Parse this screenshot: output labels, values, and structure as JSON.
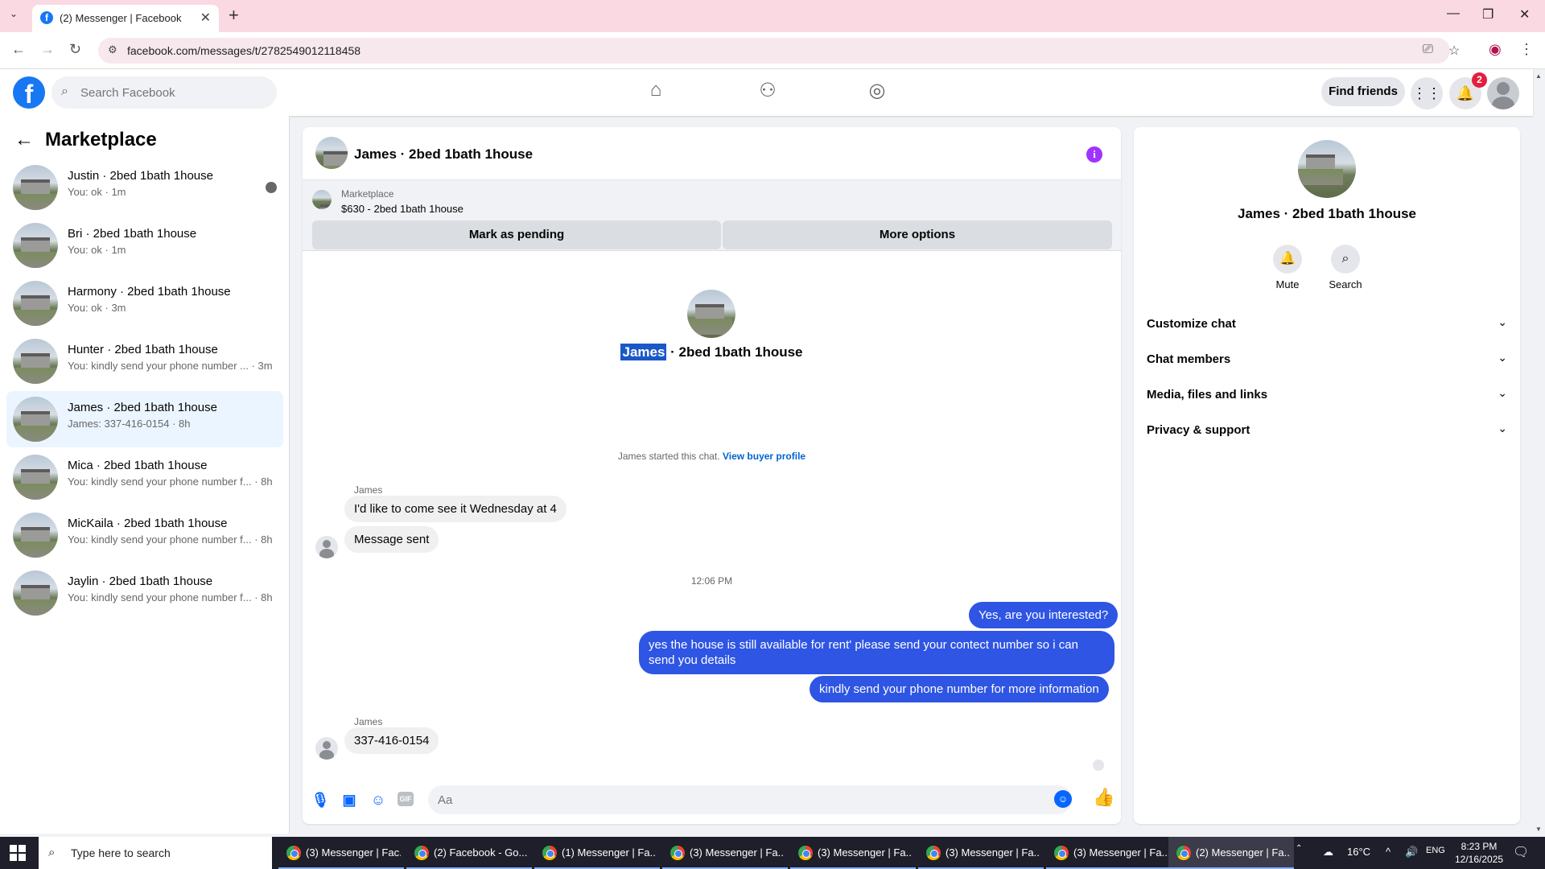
{
  "browser": {
    "tab_title": "(2) Messenger | Facebook",
    "tab_favicon": "f",
    "url": "facebook.com/messages/t/2782549012118458"
  },
  "fb": {
    "search_placeholder": "Search Facebook",
    "find_friends": "Find friends",
    "notif_count": "2"
  },
  "sidebar": {
    "title": "Marketplace",
    "conversations": [
      {
        "name": "Justin · 2bed 1bath 1house",
        "sub": "You: ok · 1m"
      },
      {
        "name": "Bri · 2bed 1bath 1house",
        "sub": "You: ok · 1m"
      },
      {
        "name": "Harmony · 2bed 1bath 1house",
        "sub": "You: ok · 3m"
      },
      {
        "name": "Hunter · 2bed 1bath 1house",
        "sub": "You: kindly send your phone number ... · 3m"
      },
      {
        "name": "James · 2bed 1bath 1house",
        "sub": "James: 337-416-0154 · 8h"
      },
      {
        "name": "Mica · 2bed 1bath 1house",
        "sub": "You: kindly send your phone number f... · 8h"
      },
      {
        "name": "MicKaila · 2bed 1bath 1house",
        "sub": "You: kindly send your phone number f... · 8h"
      },
      {
        "name": "Jaylin · 2bed 1bath 1house",
        "sub": "You: kindly send your phone number f... · 8h"
      }
    ]
  },
  "chat": {
    "header_name": "James · 2bed 1bath 1house",
    "marketplace_label": "Marketplace",
    "listing": "$630 - 2bed 1bath 1house",
    "mark_pending": "Mark as pending",
    "more_options": "More options",
    "thread_title_highlight": "James",
    "thread_title_rest": " · 2bed 1bath 1house",
    "started_text": "James started this chat.",
    "view_buyer_profile": "View buyer profile",
    "sender": "James",
    "msg1": "I'd like to come see it Wednesday at 4",
    "msg2": "Message sent",
    "timestamp": "12:06 PM",
    "out1": "Yes, are you interested?",
    "out2": "yes the house is still available for rent' please send your contect number so i can send you details",
    "out3": "kindly send your phone number for more information",
    "sender2": "James",
    "msg3": "337-416-0154",
    "composer_placeholder": "Aa",
    "gif_label": "GIF"
  },
  "info": {
    "name": "James · 2bed 1bath 1house",
    "mute": "Mute",
    "search": "Search",
    "sections": [
      "Customize chat",
      "Chat members",
      "Media, files and links",
      "Privacy & support"
    ]
  },
  "taskbar": {
    "search_text": "Type here to search",
    "apps": [
      "(3) Messenger | Fac...",
      "(2) Facebook - Go...",
      "(1) Messenger | Fa...",
      "(3) Messenger | Fa...",
      "(3) Messenger | Fa...",
      "(3) Messenger | Fa...",
      "(3) Messenger | Fa...",
      "(2) Messenger | Fa..."
    ],
    "weather": "16°C",
    "lang": "ENG",
    "time": "8:23 PM",
    "date": "12/16/2025"
  },
  "colors": {
    "fb_blue": "#1877f2",
    "outgoing_bubble": "#2f55e4",
    "active_conv": "#ebf5ff",
    "info_purple": "#a033ff"
  }
}
